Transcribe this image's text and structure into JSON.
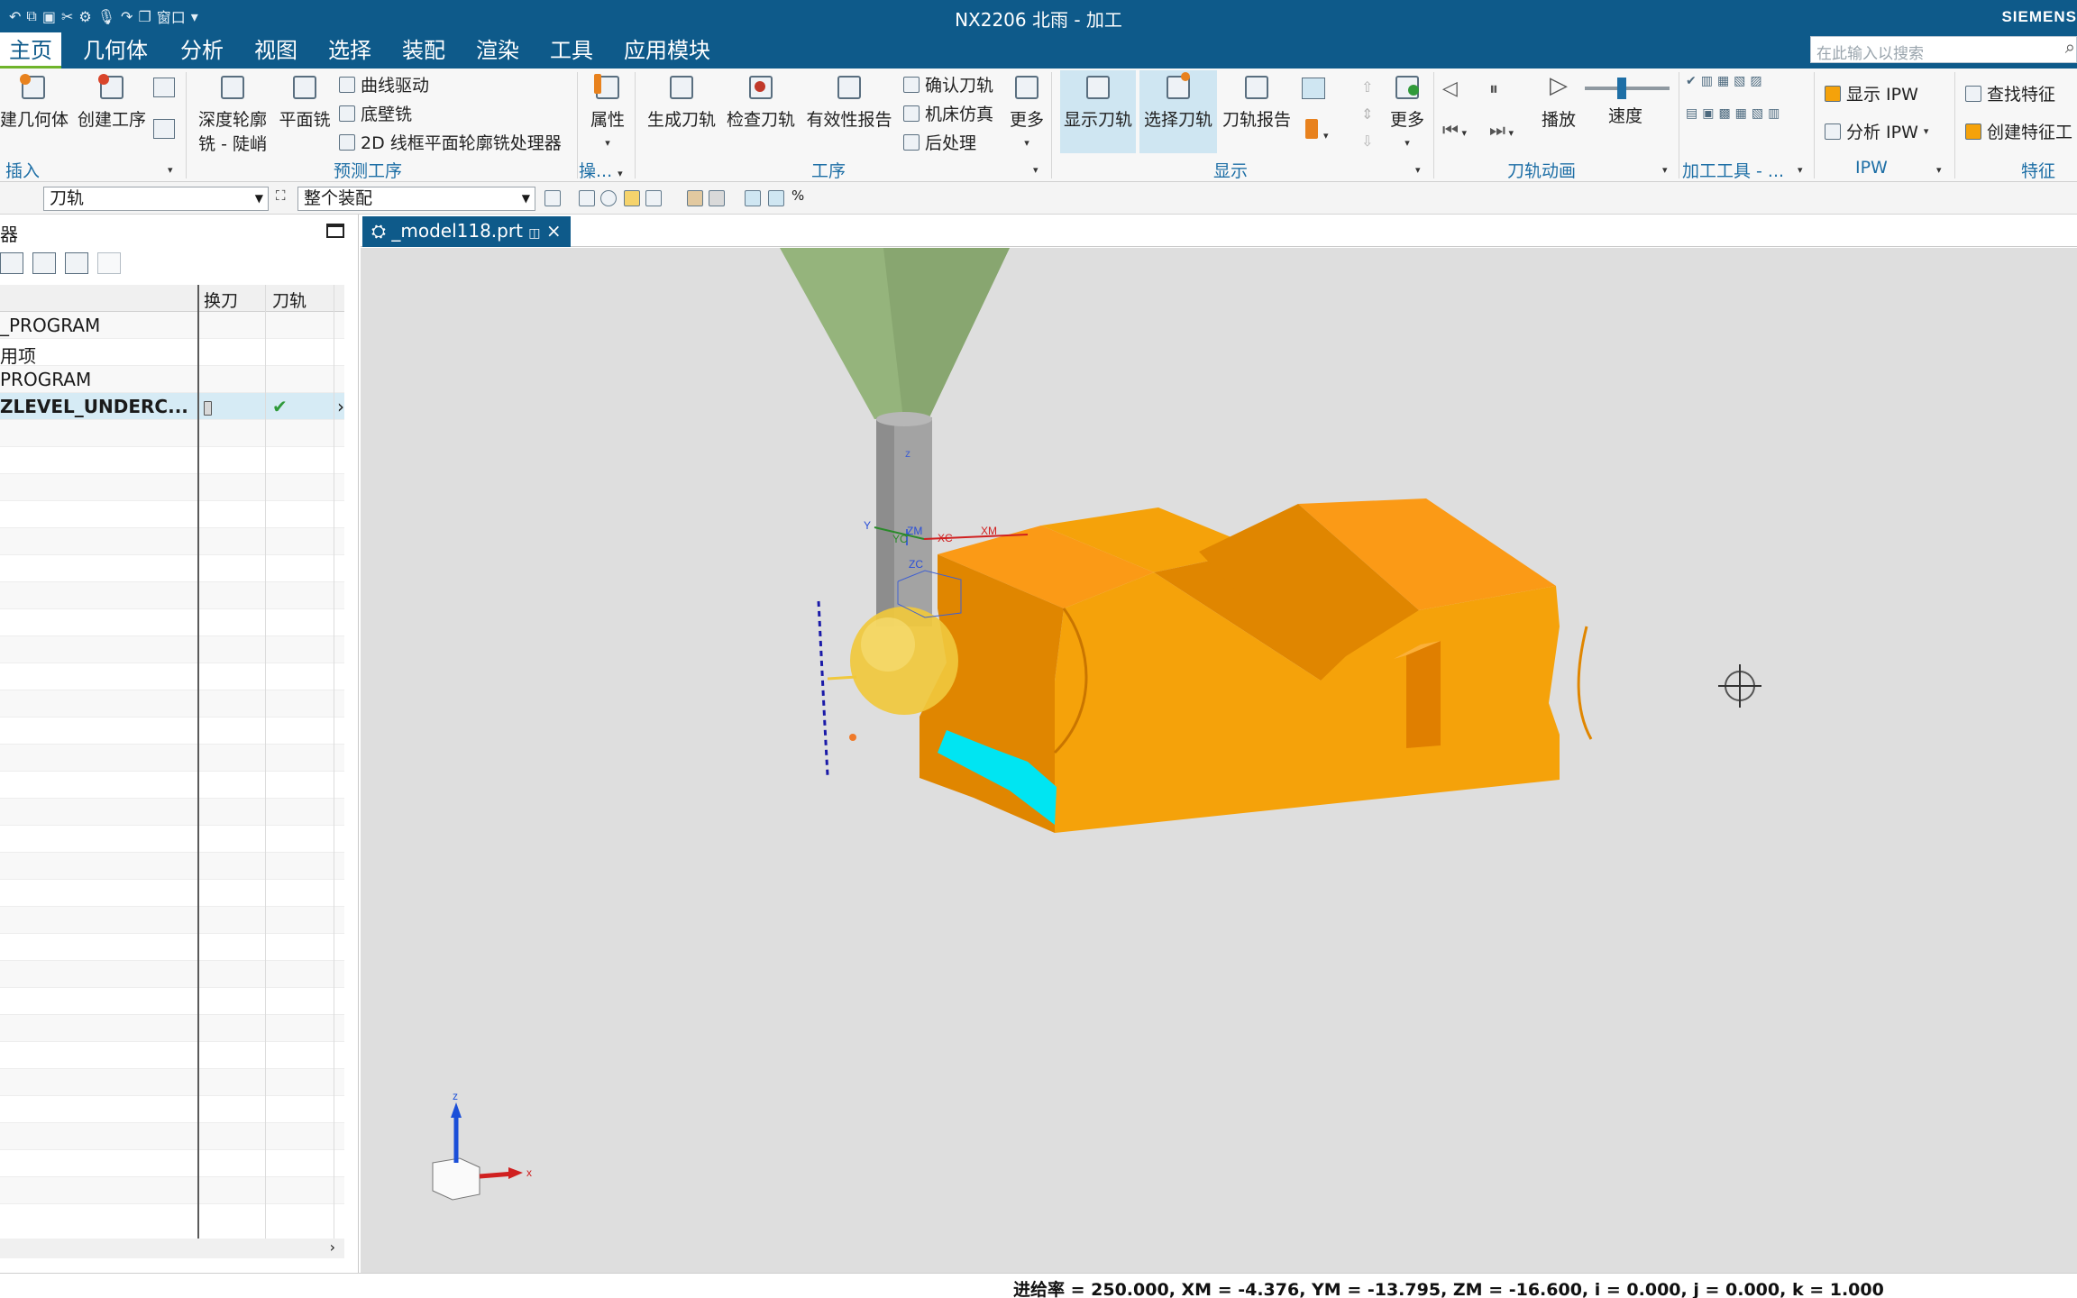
{
  "titlebar": {
    "title": "NX2206 北雨 - 加工",
    "window_menu": "窗口",
    "brand": "SIEMENS"
  },
  "menubar": {
    "items": [
      "主页",
      "几何体",
      "分析",
      "视图",
      "选择",
      "装配",
      "渲染",
      "工具",
      "应用模块"
    ],
    "active": "主页",
    "search_placeholder": "在此输入以搜索"
  },
  "ribbon": {
    "insert": {
      "create_geometry": "建几何体",
      "create_operation": "创建工序",
      "label": "插入"
    },
    "predict": {
      "depth_profile_1": "深度轮廓",
      "depth_profile_2": "铣 - 陡峭",
      "planar_mill": "平面铣",
      "curve_drive": "曲线驱动",
      "floor_wall": "底壁铣",
      "wireframe": "2D 线框平面轮廓铣处理器",
      "label": "预测工序"
    },
    "ops": {
      "properties": "属性",
      "label": "操..."
    },
    "operation": {
      "generate": "生成刀轨",
      "verify": "检查刀轨",
      "validity": "有效性报告",
      "confirm": "确认刀轨",
      "simulate": "机床仿真",
      "postprocess": "后处理",
      "more": "更多",
      "label": "工序"
    },
    "display": {
      "show_toolpath": "显示刀轨",
      "select_toolpath": "选择刀轨",
      "toolpath_report": "刀轨报告",
      "more": "更多",
      "label": "显示"
    },
    "animation": {
      "play": "播放",
      "speed": "速度",
      "label": "刀轨动画"
    },
    "tools": {
      "label": "加工工具 - ..."
    },
    "ipw": {
      "show": "显示 IPW",
      "analyze": "分析 IPW",
      "label": "IPW"
    },
    "feature": {
      "find": "查找特征",
      "create": "创建特征工",
      "label": "特征"
    }
  },
  "filterbar": {
    "type_filter": "刀轨",
    "scope_filter": "整个装配"
  },
  "navigator": {
    "title": "器",
    "columns": [
      "",
      "换刀",
      "刀轨"
    ],
    "rows": [
      {
        "name": "_PROGRAM",
        "tool_change": "",
        "toolpath": ""
      },
      {
        "name": "用项",
        "tool_change": "",
        "toolpath": ""
      },
      {
        "name": "PROGRAM",
        "tool_change": "",
        "toolpath": ""
      },
      {
        "name": "ZLEVEL_UNDERC...",
        "tool_change": "tool",
        "toolpath": "✔",
        "selected": true
      }
    ],
    "scroll_right": "›"
  },
  "document": {
    "tab_label": "_model118.prt",
    "close": "×"
  },
  "viewport": {
    "wcs": {
      "zm": "ZM",
      "zc": "ZC",
      "yc": "YC",
      "xc": "XC",
      "xm": "XM",
      "y": "Y",
      "z": "z",
      "x": "x"
    },
    "colors": {
      "part": "#f5a20a",
      "part_dark": "#e08600",
      "part_top": "#fb9a16",
      "holder": "#95b47c",
      "shank": "#a3a3a3",
      "ball": "#f0c83c",
      "machined": "#00e5f2"
    }
  },
  "statusbar": {
    "text": "进给率 = 250.000, XM = -4.376, YM = -13.795, ZM = -16.600, i = 0.000, j = 0.000, k = 1.000"
  }
}
